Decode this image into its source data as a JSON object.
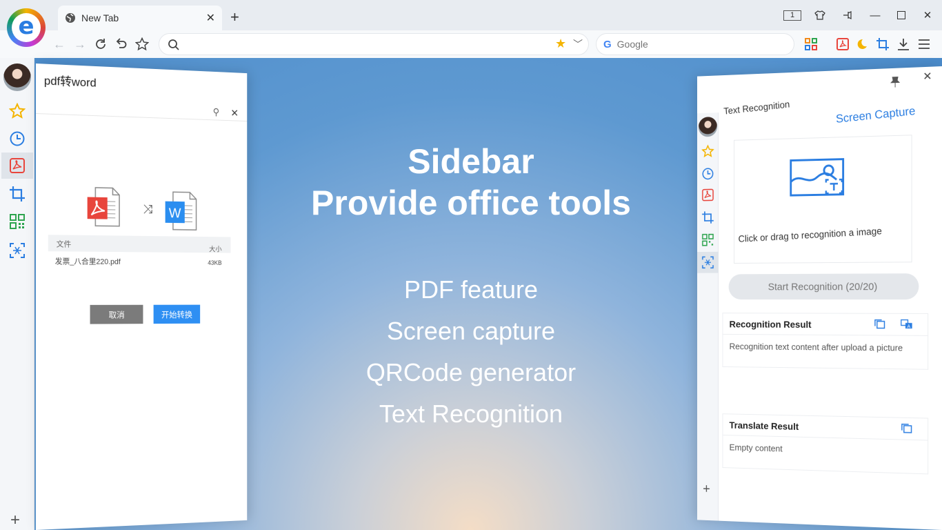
{
  "browser": {
    "tab_title": "New Tab",
    "tab_counter": "1",
    "search_placeholder": "Google",
    "address_value": ""
  },
  "hero": {
    "headline_line1": "Sidebar",
    "headline_line2": "Provide office tools",
    "features": [
      "PDF feature",
      "Screen capture",
      "QRCode generator",
      "Text Recognition"
    ]
  },
  "left_panel": {
    "title": "pdf转word",
    "table_headers": [
      "文件",
      "大小"
    ],
    "file_name": "发票_八合里220.pdf",
    "file_size": "43KB",
    "cancel_label": "取消",
    "start_label": "开始转换"
  },
  "right_panel": {
    "title": "Text Recognition",
    "capture_link": "Screen Capture",
    "dropzone_text": "Click or drag to recognition a image",
    "start_button": "Start Recognition (20/20)",
    "recognition_title": "Recognition Result",
    "recognition_body": "Recognition text content after upload a picture",
    "translate_title": "Translate Result",
    "translate_body": "Empty content"
  },
  "colors": {
    "accent": "#2a7de1",
    "pdf_red": "#e8453c",
    "qr_green": "#2ea44f",
    "favorite": "#f4b400"
  }
}
